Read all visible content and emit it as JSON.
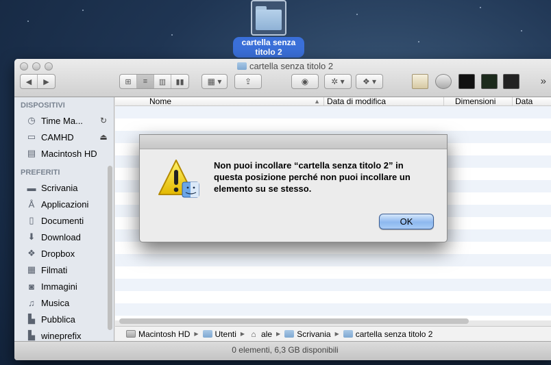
{
  "desktop": {
    "folder_label": "cartella senza titolo 2"
  },
  "window": {
    "title": "cartella senza titolo 2",
    "toolbar": {
      "back_icon": "chevron-left-icon",
      "forward_icon": "chevron-right-icon",
      "more_label": "»"
    },
    "sidebar": {
      "sections": [
        {
          "heading": "DISPOSITIVI",
          "items": [
            {
              "label": "Time Ma...",
              "icon": "time-machine-icon",
              "extra": "sync-icon"
            },
            {
              "label": "CAMHD",
              "icon": "drive-icon",
              "extra": "eject-icon"
            },
            {
              "label": "Macintosh HD",
              "icon": "hard-drive-icon"
            }
          ]
        },
        {
          "heading": "PREFERITI",
          "items": [
            {
              "label": "Scrivania",
              "icon": "desktop-icon"
            },
            {
              "label": "Applicazioni",
              "icon": "applications-icon"
            },
            {
              "label": "Documenti",
              "icon": "documents-icon"
            },
            {
              "label": "Download",
              "icon": "download-icon"
            },
            {
              "label": "Dropbox",
              "icon": "dropbox-icon"
            },
            {
              "label": "Filmati",
              "icon": "movies-icon"
            },
            {
              "label": "Immagini",
              "icon": "pictures-icon"
            },
            {
              "label": "Musica",
              "icon": "music-icon"
            },
            {
              "label": "Pubblica",
              "icon": "public-folder-icon"
            },
            {
              "label": "wineprefix",
              "icon": "folder-icon"
            }
          ]
        }
      ]
    },
    "list": {
      "columns": [
        "Nome",
        "Data di modifica",
        "Dimensioni",
        "Data"
      ]
    },
    "pathbar": [
      "Macintosh HD",
      "Utenti",
      "ale",
      "Scrivania",
      "cartella senza titolo 2"
    ],
    "status": "0 elementi, 6,3 GB disponibili"
  },
  "dialog": {
    "message": "Non puoi incollare “cartella senza titolo 2” in questa posizione perché non puoi incollare un elemento su se stesso.",
    "ok_label": "OK"
  },
  "colors": {
    "selection_blue": "#3a6fd8",
    "ok_button": "#8db8ef",
    "sidebar_bg": "#e4e8ee",
    "row_stripe": "#eef3fa"
  }
}
